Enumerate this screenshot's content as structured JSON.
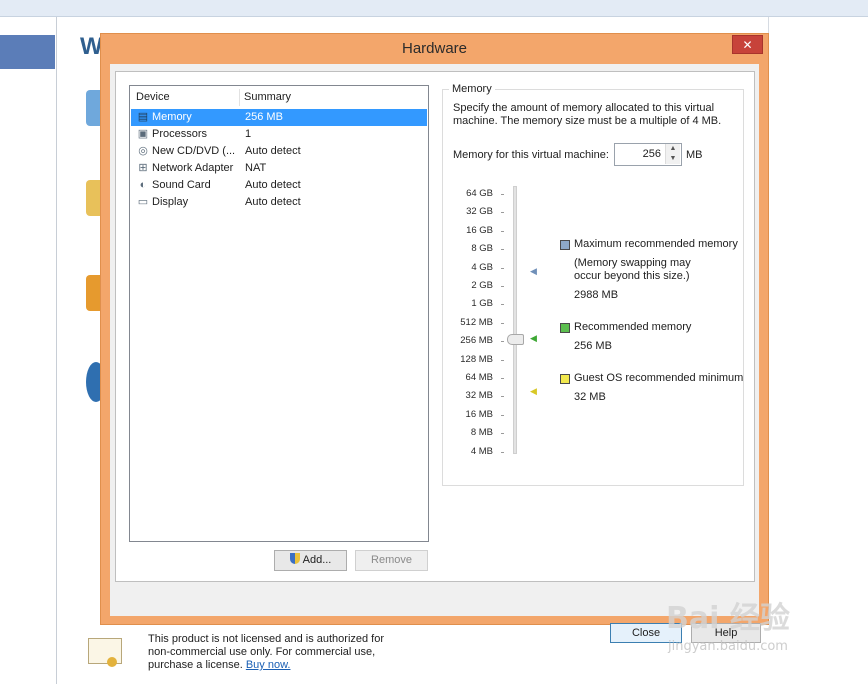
{
  "background": {
    "title_fragment": "W"
  },
  "dialog": {
    "title": "Hardware",
    "close_glyph": "✕"
  },
  "device_list": {
    "columns": [
      "Device",
      "Summary"
    ],
    "rows": [
      {
        "icon": "memory-icon",
        "name": "Memory",
        "summary": "256 MB",
        "selected": true
      },
      {
        "icon": "processor-icon",
        "name": "Processors",
        "summary": "1",
        "selected": false
      },
      {
        "icon": "cd-dvd-icon",
        "name": "New CD/DVD (...",
        "summary": "Auto detect",
        "selected": false
      },
      {
        "icon": "network-adapter-icon",
        "name": "Network Adapter",
        "summary": "NAT",
        "selected": false
      },
      {
        "icon": "sound-card-icon",
        "name": "Sound Card",
        "summary": "Auto detect",
        "selected": false
      },
      {
        "icon": "display-icon",
        "name": "Display",
        "summary": "Auto detect",
        "selected": false
      }
    ],
    "add_label": "Add...",
    "remove_label": "Remove"
  },
  "memory": {
    "group_title": "Memory",
    "description": "Specify the amount of memory allocated to this virtual machine. The memory size must be a multiple of 4 MB.",
    "field_label": "Memory for this virtual machine:",
    "value": "256",
    "unit": "MB",
    "scale": [
      "64 GB",
      "32 GB",
      "16 GB",
      "8 GB",
      "4 GB",
      "2 GB",
      "1 GB",
      "512 MB",
      "256 MB",
      "128 MB",
      "64 MB",
      "32 MB",
      "16 MB",
      "8 MB",
      "4 MB"
    ],
    "slider_value": "256 MB",
    "legend": {
      "max": {
        "title": "Maximum recommended memory",
        "note": "(Memory swapping may\noccur beyond this size.)",
        "value": "2988 MB",
        "color": "#8ea9c8"
      },
      "recommended": {
        "title": "Recommended memory",
        "value": "256 MB",
        "color": "#5cbf4f"
      },
      "minimum": {
        "title": "Guest OS recommended minimum",
        "value": "32 MB",
        "color": "#f2e94e"
      }
    }
  },
  "footer": {
    "close_label": "Close",
    "help_label": "Help"
  },
  "license": {
    "text": "This product is not licensed and is authorized for non-commercial use only. For commercial use, purchase a license.",
    "link": "Buy now."
  },
  "watermark": {
    "big": "Bai 经验",
    "small": "jingyan.baidu.com"
  }
}
